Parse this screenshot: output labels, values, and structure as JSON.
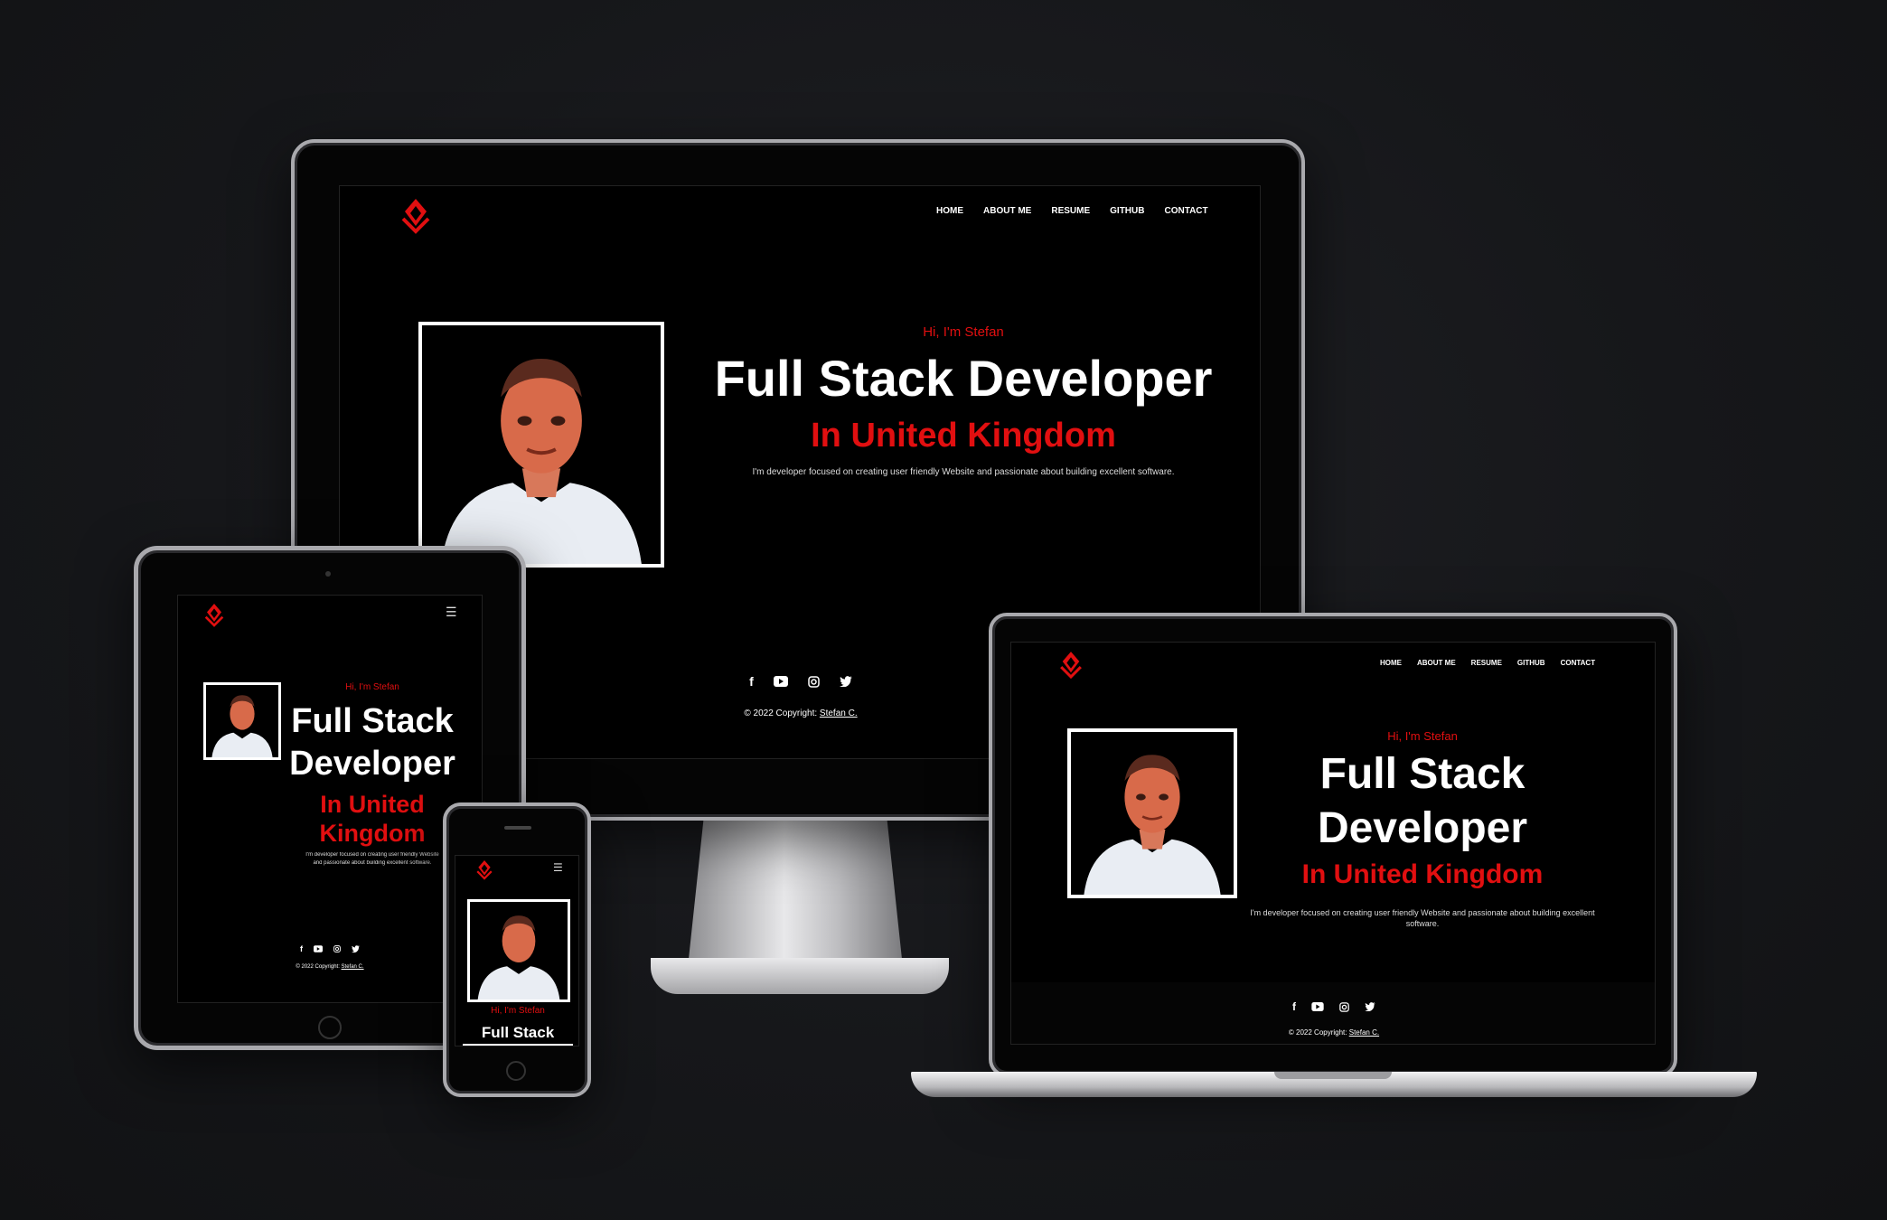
{
  "site": {
    "nav": [
      "HOME",
      "ABOUT ME",
      "RESUME",
      "GITHUB",
      "CONTACT"
    ],
    "greeting": "Hi, I'm Stefan",
    "title": "Full Stack Developer",
    "title_line1": "Full Stack",
    "title_line2": "Developer",
    "subtitle": "In United Kingdom",
    "subtitle_line1": "In United",
    "subtitle_line2": "Kingdom",
    "description": "I'm developer focused on creating user friendly Website and passionate about building excellent software.",
    "description_tablet_1": "I'm developer focused on creating user friendly Website",
    "description_tablet_2": "and passionate about building excellent software.",
    "description_laptop_1": "I'm developer focused on creating user friendly Website and passionate about building excellent",
    "description_laptop_2": "software.",
    "copyright_prefix": "© 2022 Copyright: ",
    "copyright_name": "Stefan C.",
    "menu_icon": "hamburger-icon",
    "socials": [
      "facebook-icon",
      "youtube-icon",
      "instagram-icon",
      "twitter-icon"
    ]
  },
  "colors": {
    "accent": "#e10f10",
    "background": "#000000",
    "text": "#ffffff"
  }
}
